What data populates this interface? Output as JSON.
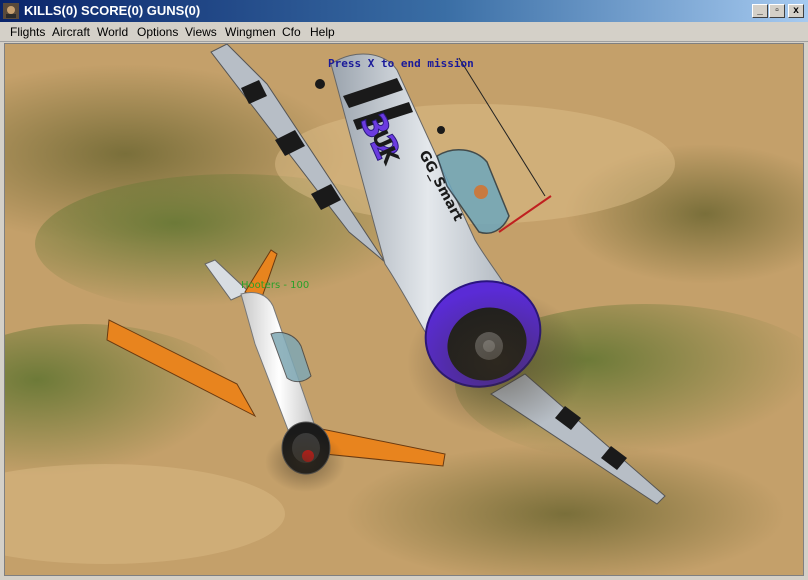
{
  "window": {
    "title": "KILLS(0) SCORE(0) GUNS(0)",
    "buttons": {
      "minimize": "_",
      "restore": "▫",
      "close": "x"
    }
  },
  "menu": [
    "Flights",
    "Aircraft",
    "World",
    "Options",
    "Views",
    "Wingmen",
    "Cfo",
    "Help"
  ],
  "hud": {
    "message": "Press X to end mission",
    "target_label": "Hooters - 100"
  },
  "aircraft": {
    "near": {
      "markings": [
        "32",
        "UK",
        "GG_Smart"
      ],
      "cowling_color": "#5a2bd6",
      "livery": "grey with black stripes"
    },
    "far": {
      "livery": "orange and white",
      "spinner_color": "#e01818"
    }
  },
  "colors": {
    "titlebar": "#0a246a",
    "hud_text": "#1a1a9a",
    "label_text": "#2aa02a"
  }
}
